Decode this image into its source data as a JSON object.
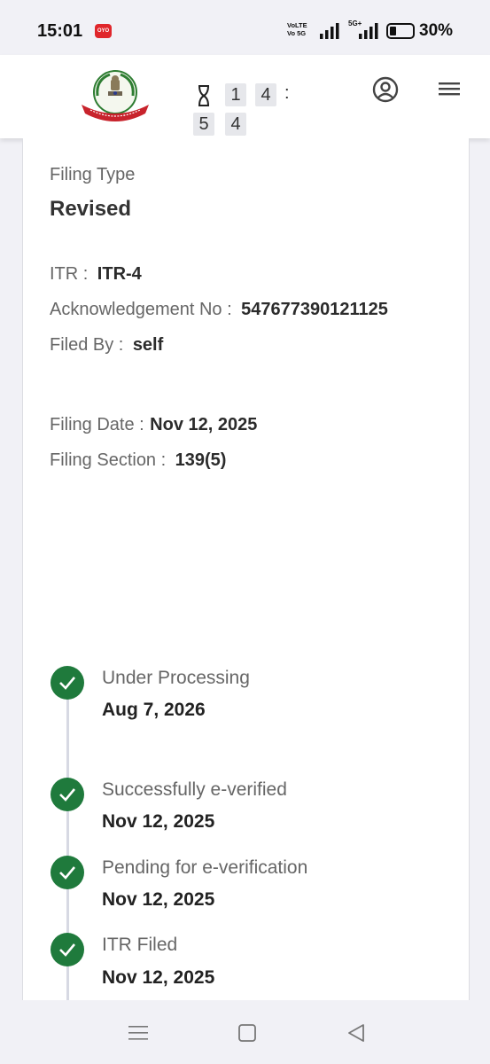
{
  "status_bar": {
    "time": "15:01",
    "oyo_badge": "OYO",
    "volte_line1": "VoLTE",
    "volte_line2": "Vo 5G",
    "network_label": "5G+",
    "battery_level": 30,
    "battery_text": "30%"
  },
  "header": {
    "logo_alt": "INCOME TAX DEPARTMENT",
    "timer_digits": [
      "1",
      "4",
      "5",
      "4"
    ],
    "timer_separator": ":"
  },
  "filing": {
    "type_label": "Filing Type",
    "type_value": "Revised",
    "itr_label": "ITR :",
    "itr_value": "ITR-4",
    "ack_label": "Acknowledgement No :",
    "ack_value": "547677390121125",
    "filed_by_label": "Filed By :",
    "filed_by_value": "self",
    "filing_date_label": "Filing Date :",
    "filing_date_value": "Nov 12, 2025",
    "filing_section_label": "Filing Section :",
    "filing_section_value": "139(5)"
  },
  "timeline": [
    {
      "status": "Under Processing",
      "date": "Aug 7, 2026"
    },
    {
      "status": "Successfully e-verified",
      "date": "Nov 12, 2025"
    },
    {
      "status": "Pending for e-verification",
      "date": "Nov 12, 2025"
    },
    {
      "status": "ITR Filed",
      "date": "Nov 12, 2025"
    }
  ],
  "colors": {
    "success_green": "#1f7a3c",
    "logo_red": "#c8232c",
    "logo_green": "#2e7d32"
  }
}
